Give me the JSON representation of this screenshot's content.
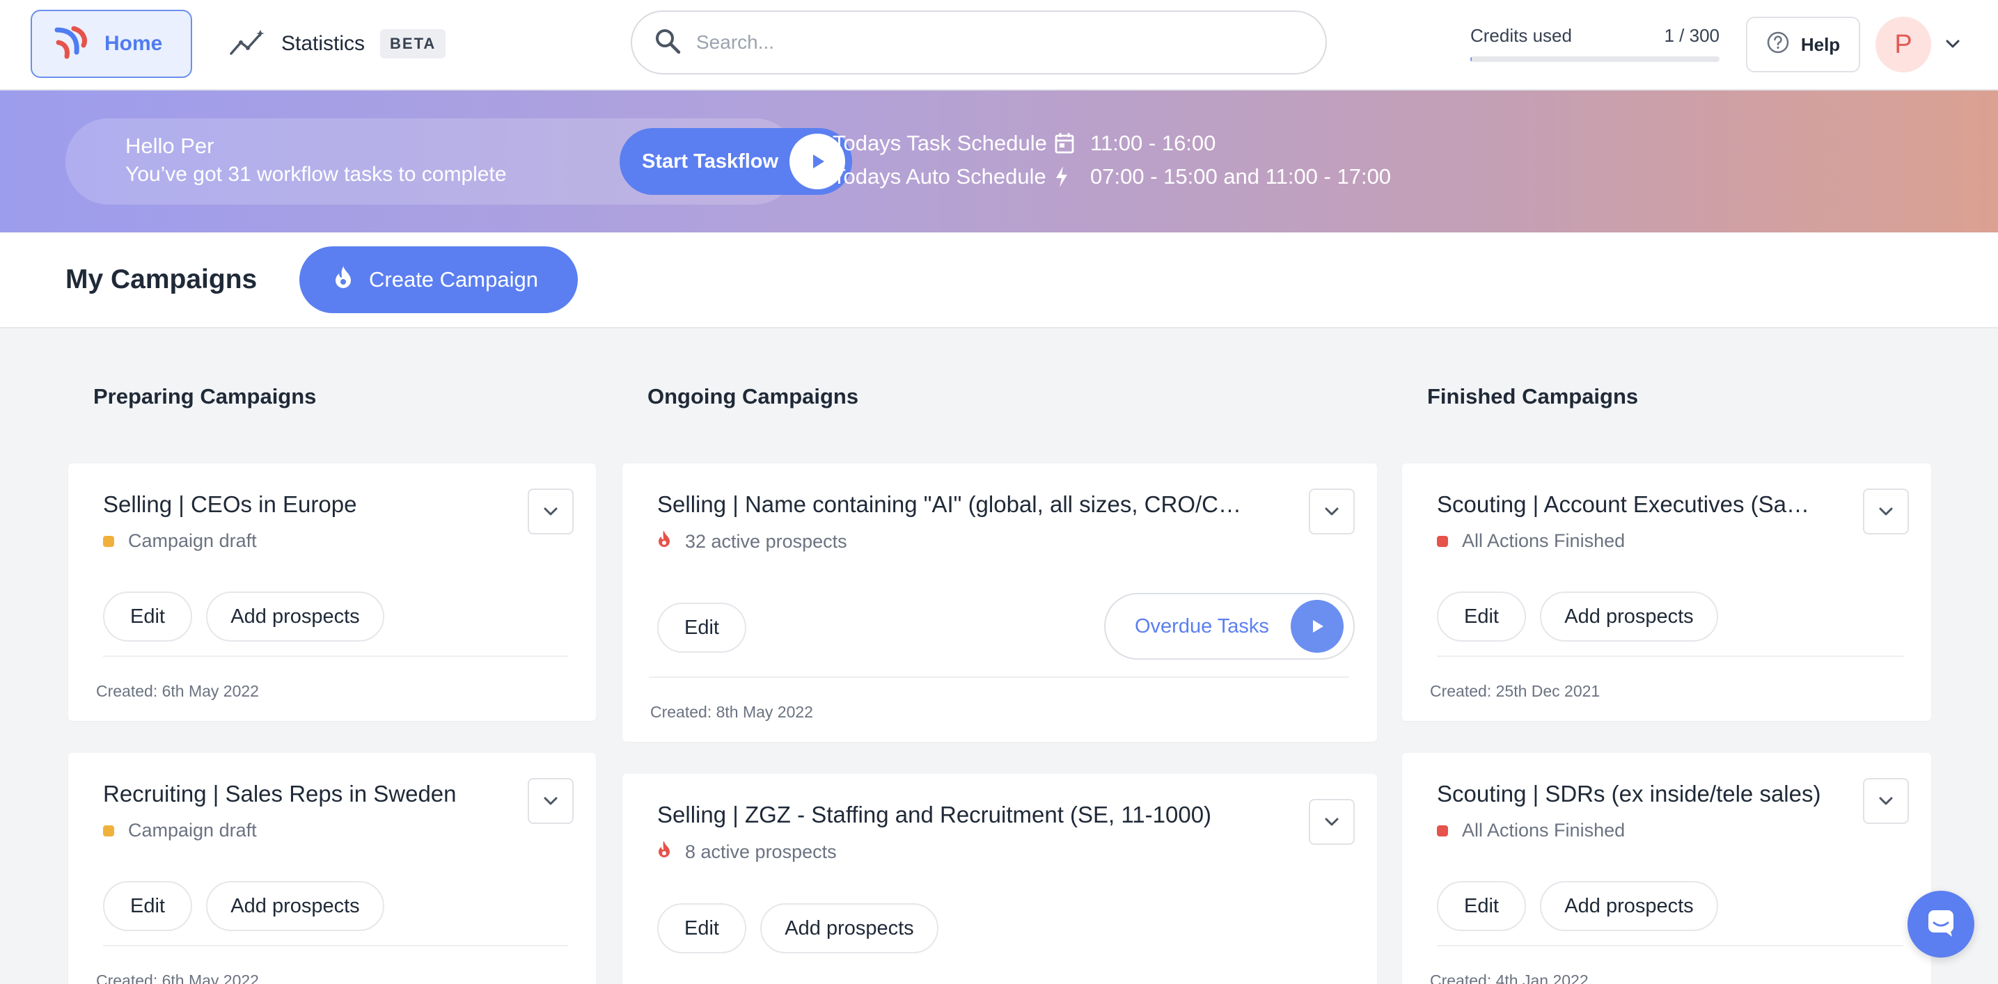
{
  "nav": {
    "home_label": "Home",
    "statistics_label": "Statistics",
    "beta_badge": "BETA",
    "search_placeholder": "Search...",
    "credits_label": "Credits used",
    "credits_value": "1 / 300",
    "credits_fraction": 0.0033,
    "help_label": "Help",
    "avatar_initial": "P"
  },
  "banner": {
    "hello": "Hello Per",
    "subtitle": "You’ve got 31 workflow tasks to complete",
    "taskflow_label": "Start Taskflow",
    "task_schedule_label": "Todays Task Schedule",
    "task_schedule_value": "11:00 - 16:00",
    "auto_schedule_label": "Todays Auto Schedule",
    "auto_schedule_value": "07:00 - 15:00 and 11:00 - 17:00"
  },
  "campaigns_header": {
    "title": "My Campaigns",
    "create_label": "Create Campaign"
  },
  "columns": {
    "preparing": {
      "title": "Preparing Campaigns",
      "cards": [
        {
          "title": "Selling | CEOs in Europe",
          "status": "Campaign draft",
          "edit": "Edit",
          "add": "Add prospects",
          "created": "Created: 6th May 2022"
        },
        {
          "title": "Recruiting | Sales Reps in Sweden",
          "status": "Campaign draft",
          "edit": "Edit",
          "add": "Add prospects",
          "created": "Created: 6th May 2022"
        }
      ]
    },
    "ongoing": {
      "title": "Ongoing Campaigns",
      "cards": [
        {
          "title": "Selling | Name containing \"AI\" (global, all sizes, CRO/CS…",
          "status": "32 active prospects",
          "edit": "Edit",
          "overdue": "Overdue Tasks",
          "created": "Created: 8th May 2022"
        },
        {
          "title": "Selling | ZGZ - Staffing and Recruitment (SE, 11-1000)",
          "status": "8 active prospects",
          "edit": "Edit",
          "add": "Add prospects"
        }
      ]
    },
    "finished": {
      "title": "Finished Campaigns",
      "cards": [
        {
          "title": "Scouting | Account Executives (Saa…",
          "status": "All Actions Finished",
          "edit": "Edit",
          "add": "Add prospects",
          "created": "Created: 25th Dec 2021"
        },
        {
          "title": "Scouting | SDRs (ex inside/tele sales)",
          "status": "All Actions Finished",
          "edit": "Edit",
          "add": "Add prospects",
          "created": "Created: 4th Jan 2022"
        }
      ]
    }
  },
  "colors": {
    "accent": "#5b7ff0",
    "draft_dot": "#f0b13c",
    "finished_dot": "#e5534b",
    "fire": "#e5534b"
  }
}
